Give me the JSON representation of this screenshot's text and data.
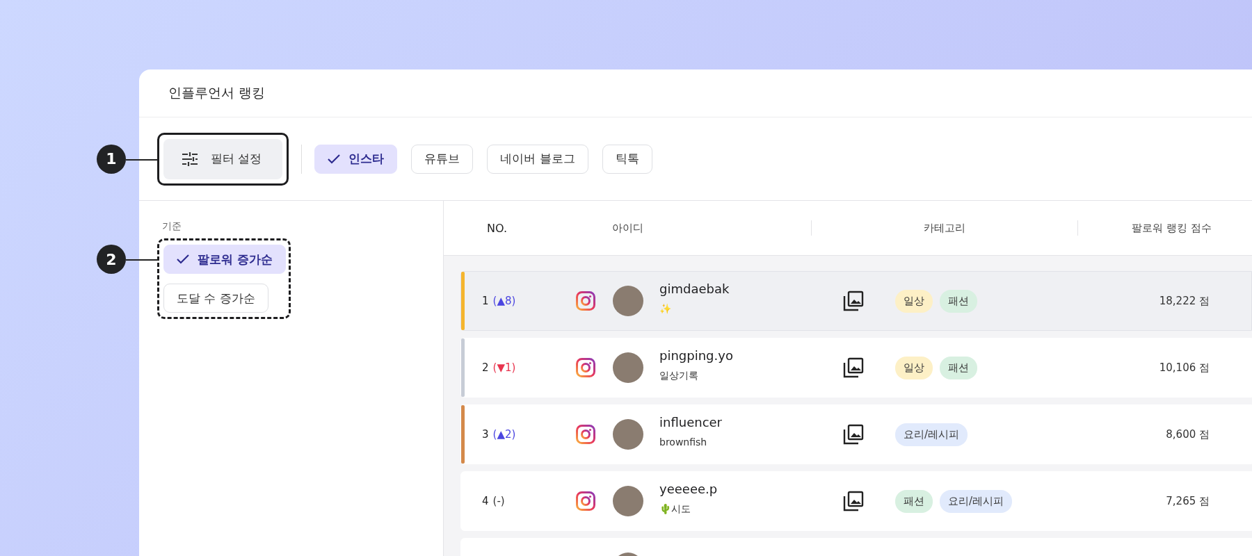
{
  "window": {
    "title": "인플루언서 랭킹"
  },
  "filter_button": {
    "label": "필터 설정"
  },
  "platforms": [
    {
      "label": "인스타",
      "selected": true
    },
    {
      "label": "유튜브",
      "selected": false
    },
    {
      "label": "네이버 블로그",
      "selected": false
    },
    {
      "label": "틱톡",
      "selected": false
    }
  ],
  "sort": {
    "label": "기준",
    "options": [
      {
        "label": "팔로워 증가순",
        "selected": true
      },
      {
        "label": "도달 수 증가순",
        "selected": false
      }
    ]
  },
  "annotations": [
    {
      "number": "1"
    },
    {
      "number": "2"
    }
  ],
  "table": {
    "columns": [
      "NO.",
      "아이디",
      "카테고리",
      "팔로워 랭킹 점수"
    ],
    "rows": [
      {
        "rank": "1",
        "change": "(▲8)",
        "kind": "up",
        "color": "#f5b52e",
        "selected": true,
        "id": "gimdaebak",
        "bio": "✨",
        "tags": [
          {
            "label": "일상",
            "color": "#fdf0c6"
          },
          {
            "label": "패션",
            "color": "#d8f0e1"
          }
        ],
        "score": "18,222 점"
      },
      {
        "rank": "2",
        "change": "(▼1)",
        "kind": "down",
        "color": "#c7ccd6",
        "selected": false,
        "id": "pingping.yo",
        "bio": "일상기록",
        "tags": [
          {
            "label": "일상",
            "color": "#fdf0c6"
          },
          {
            "label": "패션",
            "color": "#d8f0e1"
          }
        ],
        "score": "10,106 점"
      },
      {
        "rank": "3",
        "change": "(▲2)",
        "kind": "up",
        "color": "#d4894a",
        "selected": false,
        "id": "influencer",
        "bio": "brownfish",
        "tags": [
          {
            "label": "요리/레시피",
            "color": "#e1eafc"
          }
        ],
        "score": "8,600 점"
      },
      {
        "rank": "4",
        "change": "(-)",
        "kind": "same",
        "selected": false,
        "id": "yeeeee.p",
        "bio": "🌵시도",
        "tags": [
          {
            "label": "패션",
            "color": "#d8f0e1"
          },
          {
            "label": "요리/레시피",
            "color": "#e1eafc"
          }
        ],
        "score": "7,265 점"
      },
      {
        "selected": false
      }
    ]
  }
}
